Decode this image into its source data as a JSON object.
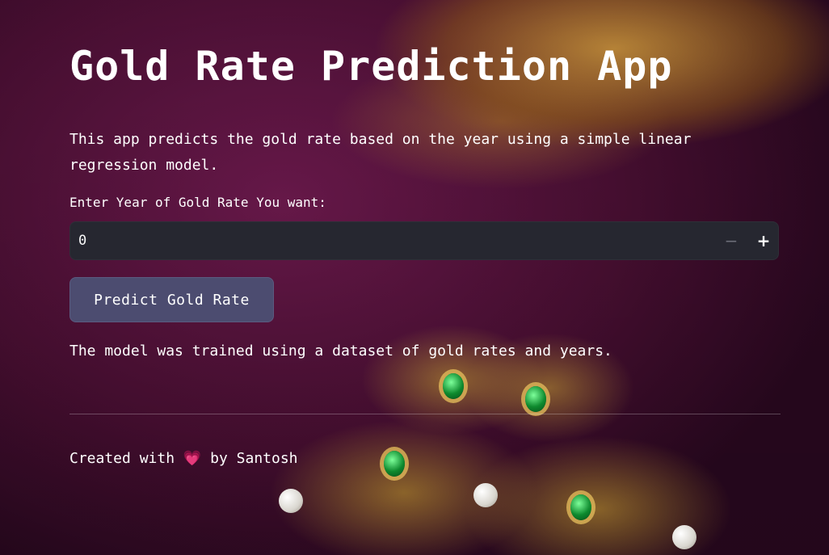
{
  "app": {
    "title": "Gold Rate Prediction App",
    "description": "This app predicts the gold rate based on the year using a simple linear regression model."
  },
  "year_input": {
    "label": "Enter Year of Gold Rate You want:",
    "value": "0",
    "decrement": "−",
    "increment": "+"
  },
  "predict_button": {
    "label": "Predict Gold Rate"
  },
  "note": "The model was trained using a dataset of gold rates and years.",
  "footer": {
    "prefix": "Created with ",
    "heart_icon": "heart-icon",
    "heart": "💗",
    "suffix": " by Santosh"
  },
  "colors": {
    "input_bg": "#262730",
    "button_bg": "#4c4c70",
    "text": "#ffffff",
    "heart": "#ff4b7d"
  }
}
